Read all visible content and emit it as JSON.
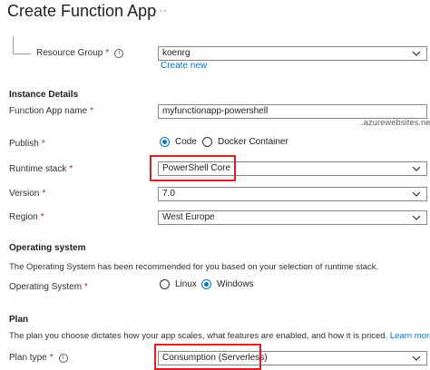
{
  "header": {
    "title": "Create Function App",
    "more_label": "···"
  },
  "resource_group": {
    "label": "Resource Group",
    "required_mark": "*",
    "info_glyph": "i",
    "value": "koenrg",
    "create_new_label": "Create new"
  },
  "instance_details": {
    "section_title": "Instance Details",
    "function_app_name": {
      "label": "Function App name",
      "required_mark": "*",
      "value": "myfunctionapp-powershell",
      "suffix": ".azurewebsites.net"
    },
    "publish": {
      "label": "Publish",
      "required_mark": "*",
      "options": [
        "Code",
        "Docker Container"
      ],
      "selected": "Code"
    },
    "runtime_stack": {
      "label": "Runtime stack",
      "required_mark": "*",
      "value": "PowerShell Core"
    },
    "version": {
      "label": "Version",
      "required_mark": "*",
      "value": "7.0"
    },
    "region": {
      "label": "Region",
      "required_mark": "*",
      "value": "West Europe"
    }
  },
  "operating_system": {
    "section_title": "Operating system",
    "description": "The Operating System has been recommended for you based on your selection of runtime stack.",
    "label": "Operating System",
    "required_mark": "*",
    "options": [
      "Linux",
      "Windows"
    ],
    "selected": "Windows"
  },
  "plan": {
    "section_title": "Plan",
    "description": "The plan you choose dictates how your app scales, what features are enabled, and how it is priced.",
    "learn_more_label": "Learn more",
    "plan_type": {
      "label": "Plan type",
      "required_mark": "*",
      "info_glyph": "i",
      "value": "Consumption (Serverless)"
    }
  },
  "colors": {
    "accent": "#0078d4",
    "required": "#a4262c",
    "highlight": "#e31b23",
    "border": "#8a8886"
  },
  "icons": {
    "dropdown": "chevron-down-icon",
    "info": "info-icon",
    "more": "more-icon"
  }
}
